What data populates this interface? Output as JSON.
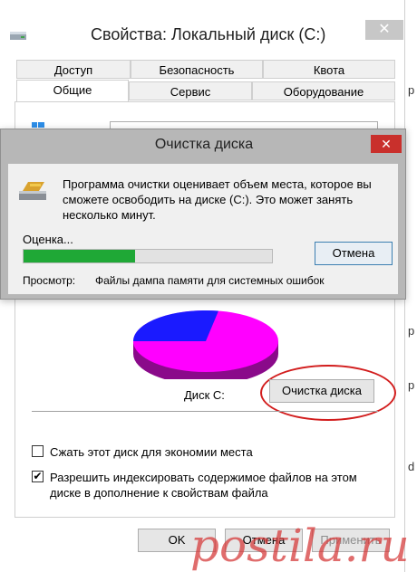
{
  "properties_window": {
    "title": "Свойства: Локальный диск (C:)",
    "close_glyph": "✕",
    "tabs_row1": [
      "Доступ",
      "Безопасность",
      "Квота"
    ],
    "tabs_row2": [
      "Общие",
      "Сервис",
      "Оборудование"
    ],
    "drive_label": "Диск C:",
    "disk_cleanup_button": "Очистка диска",
    "checkbox_compress": {
      "label": "Сжать этот диск для экономии места",
      "checked": false
    },
    "checkbox_index": {
      "label": "Разрешить индексировать содержимое файлов на этом диске в дополнение к свойствам файла",
      "checked": true
    },
    "buttons": {
      "ok": "OK",
      "cancel": "Отмена",
      "apply": "Применить"
    },
    "pie": {
      "used_color": "#ff00ff",
      "free_color": "#1a1aff",
      "side_color": "#8a0a8a"
    }
  },
  "cleanup_dialog": {
    "title": "Очистка диска",
    "close_glyph": "✕",
    "message": "Программа очистки оценивает объем места, которое вы сможете освободить на диске  (C:). Это может занять несколько минут.",
    "status": "Оценка...",
    "progress_percent": 45,
    "cancel_button": "Отмена",
    "viewing_label": "Просмотр:",
    "viewing_value": "Файлы дампа памяти для системных ошибок"
  },
  "edge_fragments": [
    "р",
    "р",
    "р",
    "d"
  ],
  "watermark": "postila.ru"
}
